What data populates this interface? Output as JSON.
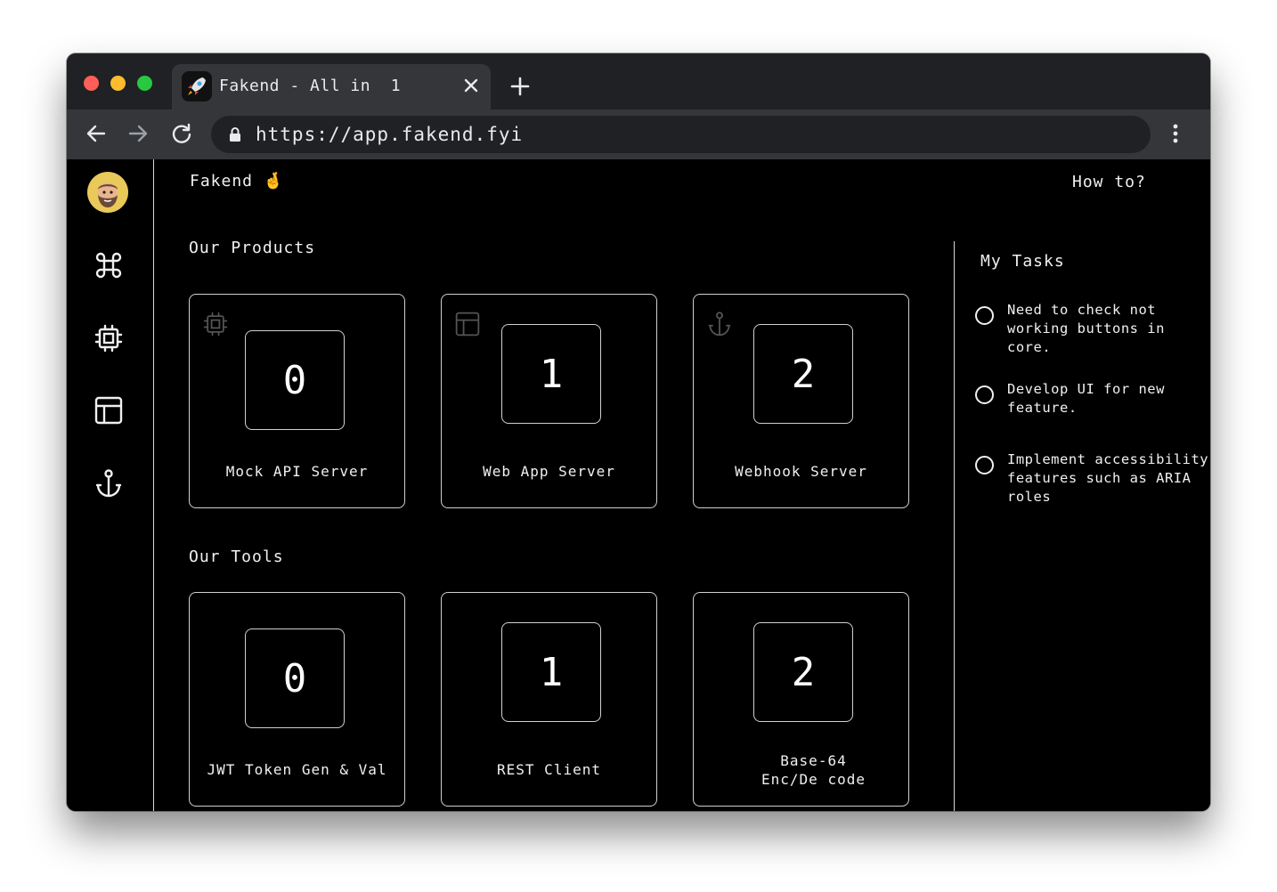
{
  "browser": {
    "tab_title": "Fakend - All in  1",
    "url": "https://app.fakend.fyi"
  },
  "app": {
    "brand": "Fakend",
    "brand_emoji": "🤞",
    "help_link": "How to?"
  },
  "sidebar": {
    "items": [
      {
        "icon": "command-icon"
      },
      {
        "icon": "cpu-icon"
      },
      {
        "icon": "layout-icon"
      },
      {
        "icon": "anchor-icon"
      }
    ]
  },
  "products": {
    "title": "Our Products",
    "cards": [
      {
        "number": "0",
        "label": "Mock API Server",
        "icon": "cpu-icon"
      },
      {
        "number": "1",
        "label": "Web App Server",
        "icon": "layout-icon"
      },
      {
        "number": "2",
        "label": "Webhook Server",
        "icon": "anchor-icon"
      }
    ]
  },
  "tools": {
    "title": "Our Tools",
    "cards": [
      {
        "number": "0",
        "label": "JWT Token Gen & Val"
      },
      {
        "number": "1",
        "label": "REST Client"
      },
      {
        "number": "2",
        "label": "Base-64 Enc/De code"
      }
    ]
  },
  "tasks": {
    "title": "My Tasks",
    "items": [
      {
        "text": "Need to check not working buttons in core."
      },
      {
        "text": "Develop UI for new feature."
      },
      {
        "text": "Implement accessibility features such as ARIA roles"
      }
    ]
  },
  "colors": {
    "window_bg": "#000000",
    "chrome_bg": "#202124",
    "toolbar_bg": "#35363a",
    "border": "#d0d0d0",
    "text": "#f0f0f0"
  }
}
